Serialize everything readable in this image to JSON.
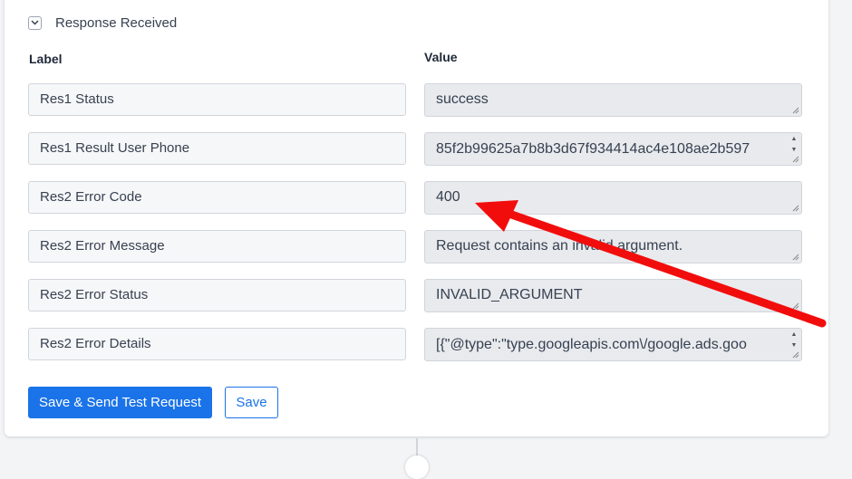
{
  "section": {
    "title": "Response Received",
    "toggle_icon": "chevron-down-icon"
  },
  "columns": {
    "label": "Label",
    "value": "Value"
  },
  "rows": [
    {
      "label": "Res1 Status",
      "value": "success",
      "has_spinner": false
    },
    {
      "label": "Res1 Result User Phone",
      "value": "85f2b99625a7b8b3d67f934414ac4e108ae2b597",
      "has_spinner": true
    },
    {
      "label": "Res2 Error Code",
      "value": "400",
      "has_spinner": false
    },
    {
      "label": "Res2 Error Message",
      "value": "Request contains an invalid argument.",
      "has_spinner": false
    },
    {
      "label": "Res2 Error Status",
      "value": "INVALID_ARGUMENT",
      "has_spinner": false
    },
    {
      "label": "Res2 Error Details",
      "value": "[{\"@type\":\"type.googleapis.com\\/google.ads.goo",
      "has_spinner": true
    }
  ],
  "buttons": {
    "primary": "Save & Send Test Request",
    "secondary": "Save"
  },
  "colors": {
    "accent": "#1a73e8",
    "annotation_arrow": "#f20d0d"
  }
}
